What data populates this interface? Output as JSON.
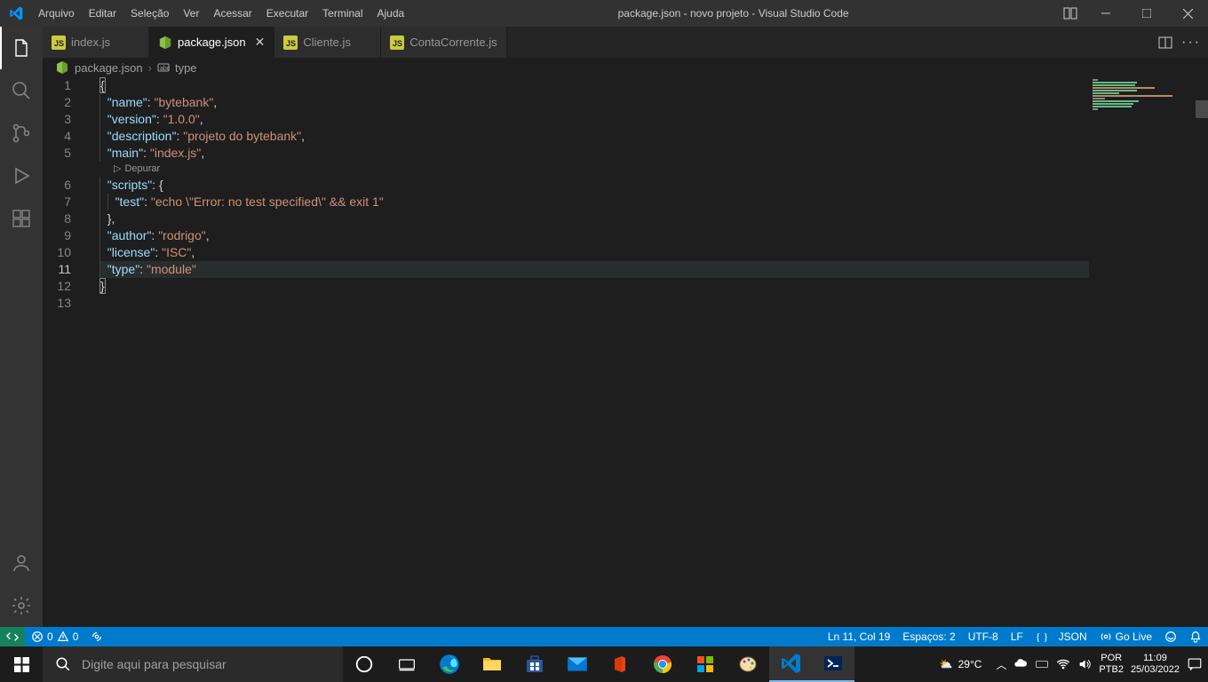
{
  "titlebar": {
    "menu": [
      "Arquivo",
      "Editar",
      "Seleção",
      "Ver",
      "Acessar",
      "Executar",
      "Terminal",
      "Ajuda"
    ],
    "title": "package.json - novo projeto - Visual Studio Code"
  },
  "tabs": [
    {
      "label": "index.js",
      "type": "js"
    },
    {
      "label": "package.json",
      "type": "npm",
      "active": true
    },
    {
      "label": "Cliente.js",
      "type": "js"
    },
    {
      "label": "ContaCorrente.js",
      "type": "js"
    }
  ],
  "breadcrumb": {
    "file": "package.json",
    "symbol": "type"
  },
  "codelens": "Depurar",
  "code_lines": [
    "1",
    "2",
    "3",
    "4",
    "5",
    "6",
    "7",
    "8",
    "9",
    "10",
    "11",
    "12",
    "13"
  ],
  "code": {
    "l1": "{",
    "l2_k": "\"name\"",
    "l2_v": "\"bytebank\"",
    "l3_k": "\"version\"",
    "l3_v": "\"1.0.0\"",
    "l4_k": "\"description\"",
    "l4_v": "\"projeto do bytebank\"",
    "l5_k": "\"main\"",
    "l5_v": "\"index.js\"",
    "l6_k": "\"scripts\"",
    "l7_k": "\"test\"",
    "l7_v": "\"echo \\\"Error: no test specified\\\" && exit 1\"",
    "l9_k": "\"author\"",
    "l9_v": "\"rodrigo\"",
    "l10_k": "\"license\"",
    "l10_v": "\"ISC\"",
    "l11_k": "\"type\"",
    "l11_v": "\"module\"",
    "l12": "}"
  },
  "statusbar": {
    "errors": "0",
    "warnings": "0",
    "cursor": "Ln 11, Col 19",
    "spaces": "Espaços: 2",
    "encoding": "UTF-8",
    "eol": "LF",
    "lang": "JSON",
    "golive": "Go Live"
  },
  "taskbar": {
    "search_placeholder": "Digite aqui para pesquisar",
    "weather": "29°C",
    "lang1": "POR",
    "lang2": "PTB2",
    "time": "11:09",
    "date": "25/03/2022"
  }
}
